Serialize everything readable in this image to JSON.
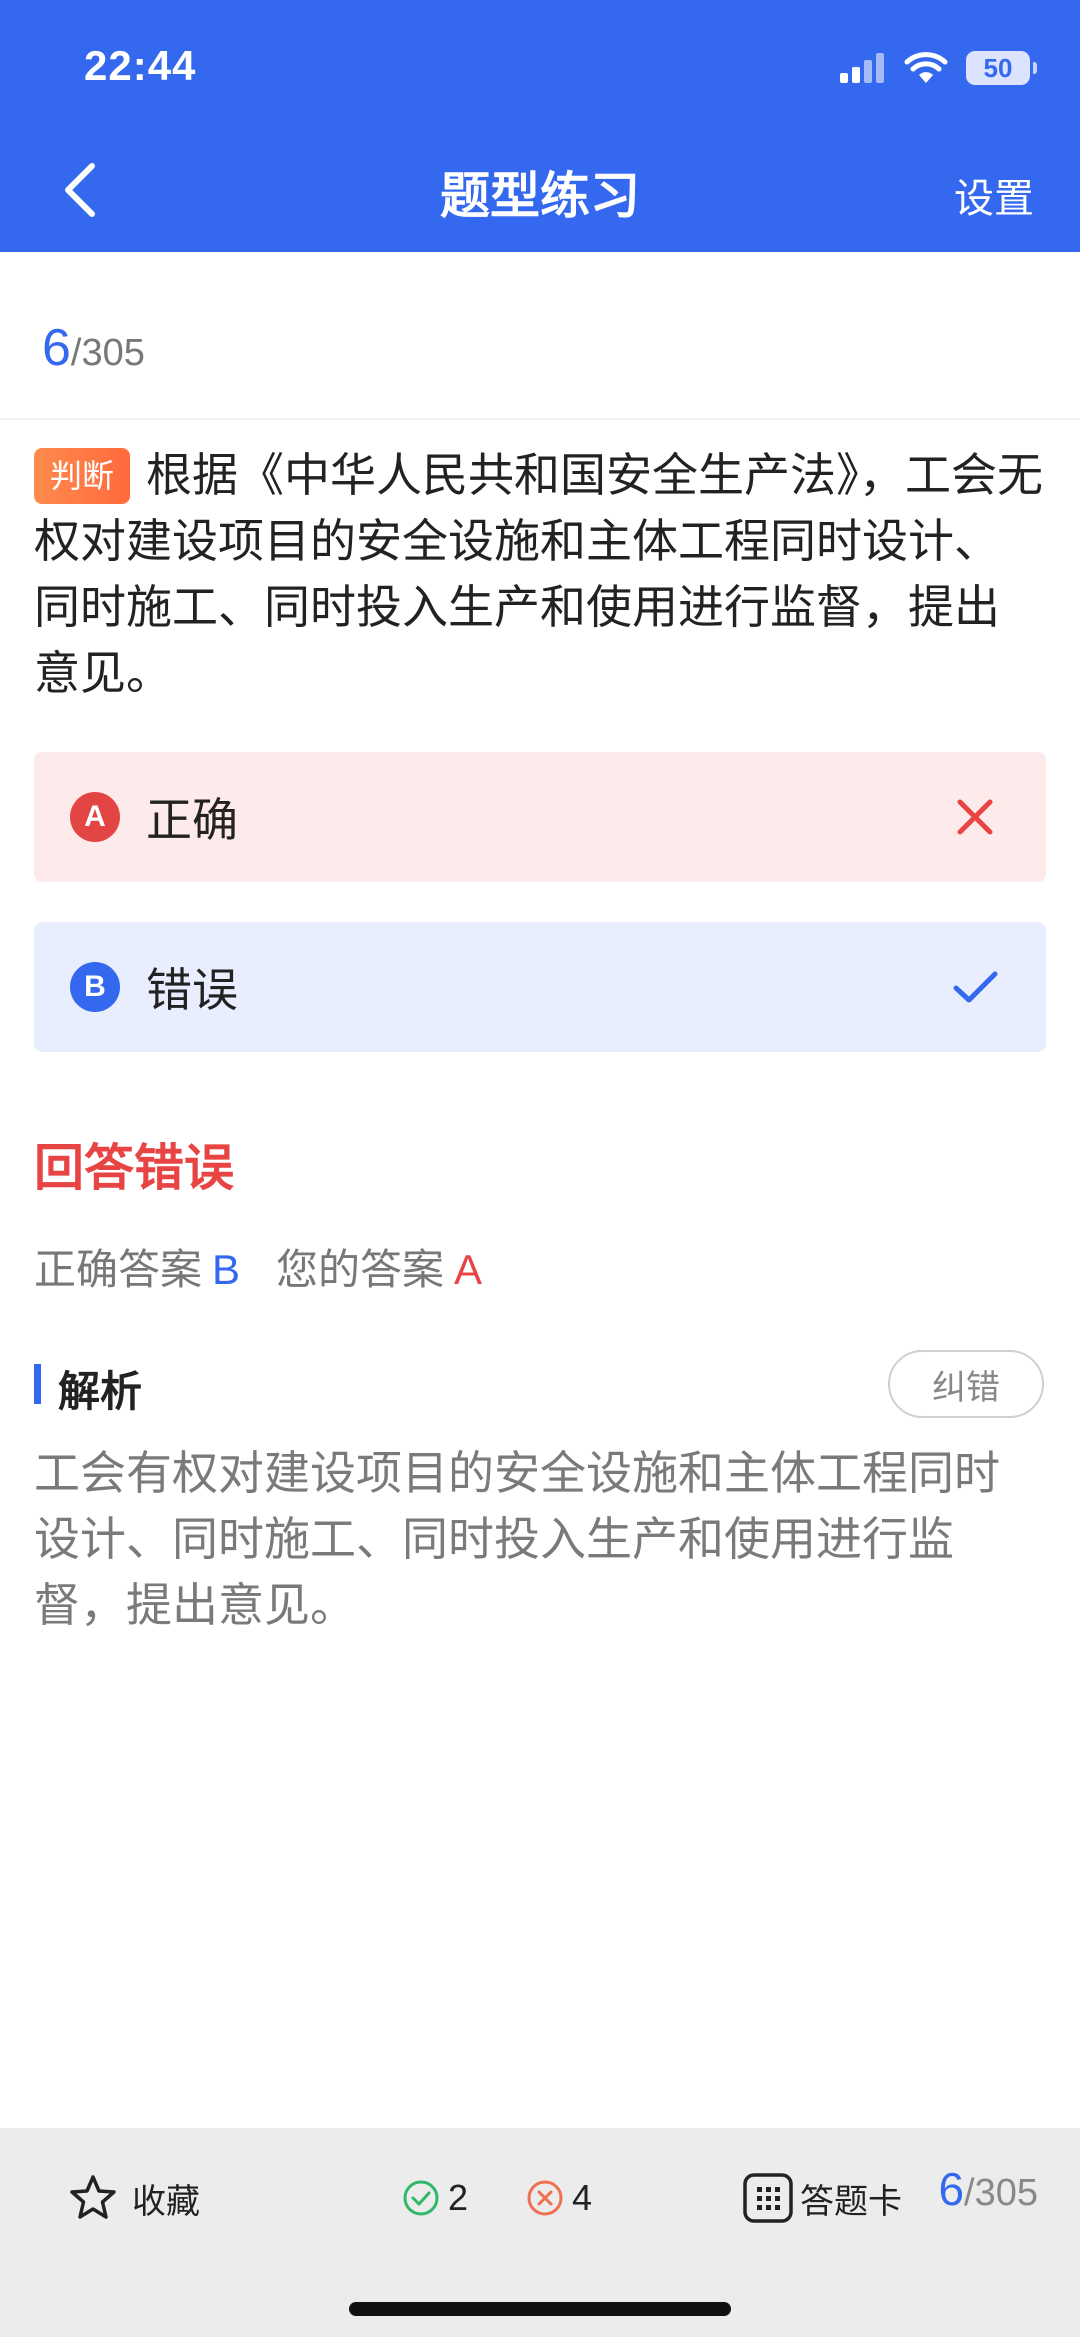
{
  "status_bar": {
    "time": "22:44",
    "battery": "50"
  },
  "header": {
    "title": "题型练习",
    "settings_label": "设置"
  },
  "progress": {
    "current": "6",
    "total": "/305"
  },
  "question": {
    "tag": "判断",
    "text": "根据《中华人民共和国安全生产法》，工会无权对建设项目的安全设施和主体工程同时设计、同时施工、同时投入生产和使用进行监督，提出意见。"
  },
  "options": [
    {
      "letter": "A",
      "text": "正确",
      "state": "wrong"
    },
    {
      "letter": "B",
      "text": "错误",
      "state": "correct"
    }
  ],
  "result": {
    "title": "回答错误",
    "correct_label": "正确答案",
    "correct_value": "B",
    "your_label": "您的答案",
    "your_value": "A"
  },
  "analysis": {
    "title": "解析",
    "report_button": "纠错",
    "text": "工会有权对建设项目的安全设施和主体工程同时设计、同时施工、同时投入生产和使用进行监督，提出意见。"
  },
  "bottom_bar": {
    "favorite_label": "收藏",
    "right_count": "2",
    "wrong_count": "4",
    "answer_card_label": "答题卡",
    "progress_current": "6",
    "progress_total": "/305"
  },
  "colors": {
    "primary": "#3468ee",
    "error": "#e84444",
    "tag": "#ff7a45",
    "success": "#2fb86a"
  }
}
